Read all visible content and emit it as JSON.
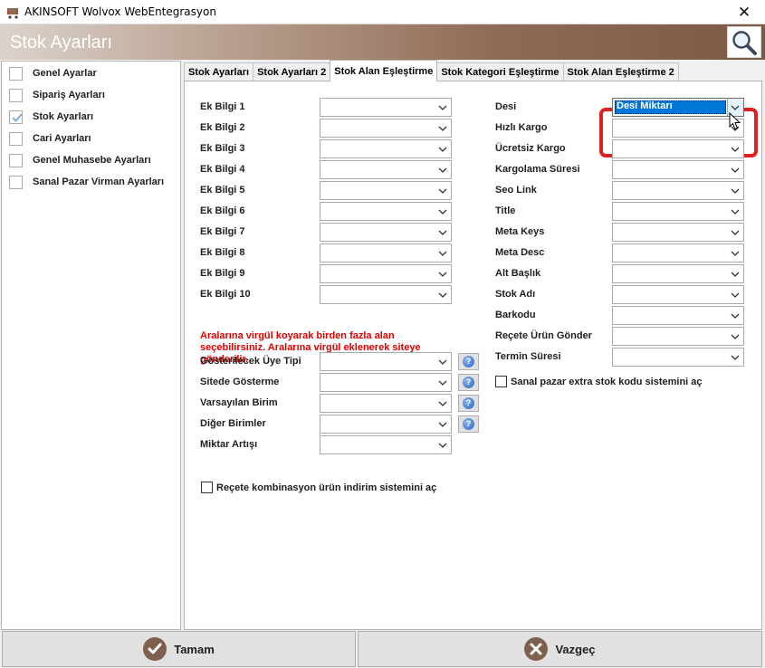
{
  "window": {
    "title": "AKINSOFT Wolvox WebEntegrasyon",
    "header_title": "Stok Ayarları"
  },
  "sidebar": {
    "items": [
      {
        "label": "Genel Ayarlar",
        "checked": false
      },
      {
        "label": "Sipariş Ayarları",
        "checked": false
      },
      {
        "label": "Stok Ayarları",
        "checked": true
      },
      {
        "label": "Cari Ayarları",
        "checked": false
      },
      {
        "label": "Genel Muhasebe Ayarları",
        "checked": false
      },
      {
        "label": "Sanal Pazar Virman Ayarları",
        "checked": false
      }
    ]
  },
  "tabs": [
    {
      "label": "Stok Ayarları",
      "active": false
    },
    {
      "label": "Stok Ayarları 2",
      "active": false
    },
    {
      "label": "Stok Alan Eşleştirme",
      "active": true
    },
    {
      "label": "Stok Kategori Eşleştirme",
      "active": false
    },
    {
      "label": "Stok Alan Eşleştirme 2",
      "active": false
    }
  ],
  "left_fields": [
    {
      "label": "Ek Bilgi 1",
      "value": ""
    },
    {
      "label": "Ek Bilgi 2",
      "value": ""
    },
    {
      "label": "Ek Bilgi 3",
      "value": ""
    },
    {
      "label": "Ek Bilgi 4",
      "value": ""
    },
    {
      "label": "Ek Bilgi 5",
      "value": ""
    },
    {
      "label": "Ek Bilgi 6",
      "value": ""
    },
    {
      "label": "Ek Bilgi 7",
      "value": ""
    },
    {
      "label": "Ek Bilgi 8",
      "value": ""
    },
    {
      "label": "Ek Bilgi 9",
      "value": ""
    },
    {
      "label": "Ek Bilgi 10",
      "value": ""
    }
  ],
  "note": "Aralarına virgül koyarak birden fazla alan seçebilirsiniz. Aralarına virgül  eklenerek siteye gönderilir.",
  "lower_fields": [
    {
      "label": "Gösterilecek Üye Tipi",
      "value": ""
    },
    {
      "label": "Sitede Gösterme",
      "value": ""
    },
    {
      "label": "Varsayılan Birim",
      "value": ""
    },
    {
      "label": "Diğer Birimler",
      "value": ""
    },
    {
      "label": "Miktar Artışı",
      "value": ""
    }
  ],
  "recete_checkbox": "Reçete kombinasyon ürün indirim sistemini aç",
  "right_fields": [
    {
      "label": "Desi",
      "value": "Desi Miktarı"
    },
    {
      "label": "Hızlı Kargo",
      "value": ""
    },
    {
      "label": "Ücretsiz Kargo",
      "value": ""
    },
    {
      "label": "Kargolama Süresi",
      "value": ""
    },
    {
      "label": "Seo Link",
      "value": ""
    },
    {
      "label": "Title",
      "value": ""
    },
    {
      "label": "Meta Keys",
      "value": ""
    },
    {
      "label": "Meta Desc",
      "value": ""
    },
    {
      "label": "Alt Başlık",
      "value": ""
    },
    {
      "label": "Stok Adı",
      "value": ""
    },
    {
      "label": "Barkodu",
      "value": ""
    },
    {
      "label": "Reçete Ürün Gönder",
      "value": ""
    },
    {
      "label": "Termin Süresi",
      "value": ""
    }
  ],
  "sanal_checkbox": "Sanal pazar extra stok kodu sistemini aç",
  "buttons": {
    "ok": "Tamam",
    "cancel": "Vazgeç"
  },
  "colors": {
    "accent_red": "#e00000",
    "highlight": "#e02020",
    "selection": "#0078d7",
    "header_brown": "#7d5a45"
  }
}
